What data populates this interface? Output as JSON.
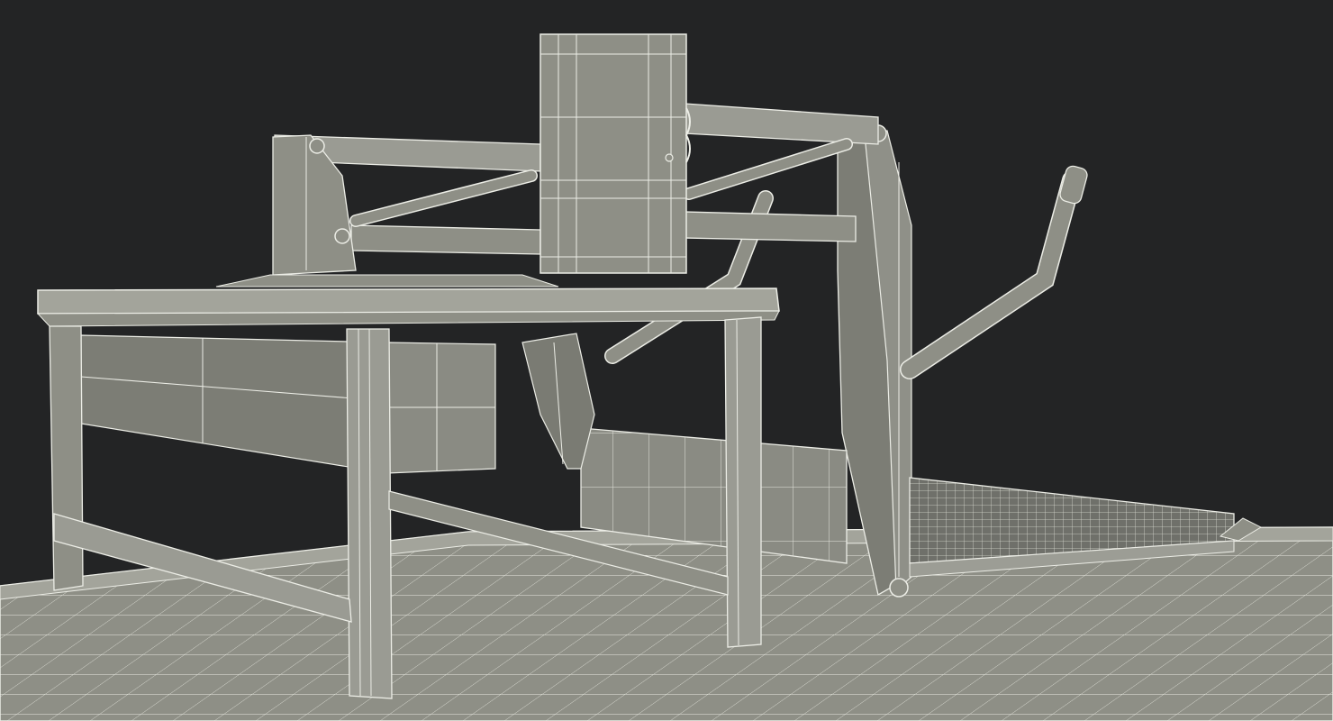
{
  "scene": {
    "colors": {
      "background": "#232425",
      "surface": "#8e8f86",
      "surface_dark": "#6f706a",
      "surface_light": "#a3a49b",
      "wire": "#ecede6"
    }
  }
}
